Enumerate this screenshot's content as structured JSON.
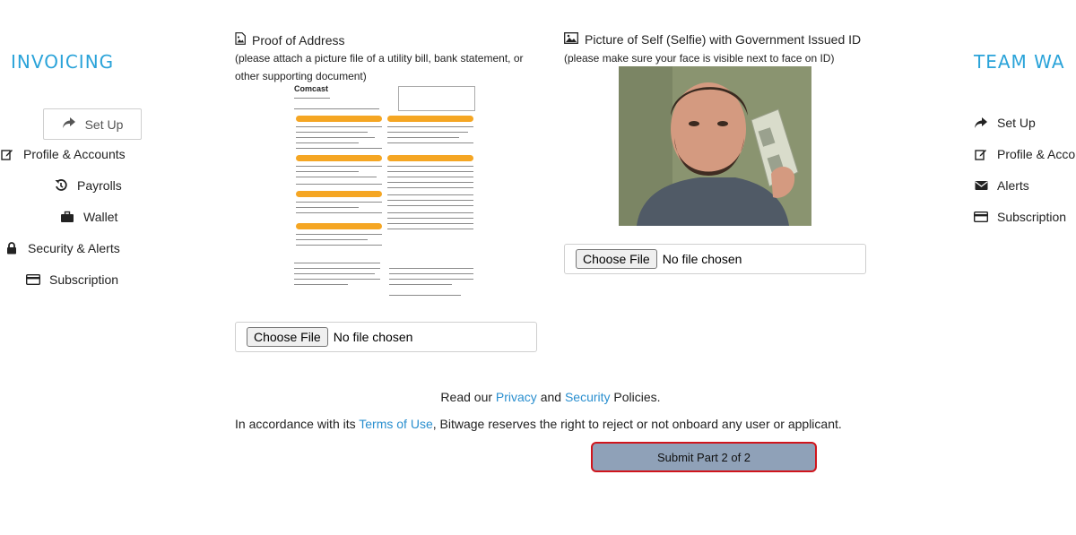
{
  "left_nav": {
    "title": "INVOICING",
    "setup_label": "Set Up",
    "items": [
      {
        "label": "Profile & Accounts",
        "icon": "edit-icon"
      },
      {
        "label": "Payrolls",
        "icon": "history-icon"
      },
      {
        "label": "Wallet",
        "icon": "briefcase-icon"
      },
      {
        "label": "Security & Alerts",
        "icon": "lock-icon"
      },
      {
        "label": "Subscription",
        "icon": "credit-card-icon"
      }
    ]
  },
  "right_nav": {
    "title": "TEAM WA",
    "setup_label": "Set Up",
    "items": [
      {
        "label": "Profile & Accou",
        "icon": "edit-icon"
      },
      {
        "label": "Alerts",
        "icon": "envelope-icon"
      },
      {
        "label": "Subscription",
        "icon": "credit-card-icon"
      }
    ]
  },
  "proof_of_address": {
    "heading": "Proof of Address",
    "note": "(please attach a picture file of a utility bill, bank statement, or other supporting document)",
    "doc_brand": "Comcast",
    "file_button": "Choose File",
    "file_status": "No file chosen"
  },
  "selfie": {
    "heading": "Picture of Self (Selfie) with Government Issued ID",
    "note": "(please make sure your face is visible next to face on ID)",
    "file_button": "Choose File",
    "file_status": "No file chosen"
  },
  "policies": {
    "prefix": "Read our",
    "privacy_link": "Privacy",
    "and": "and",
    "security_link": "Security",
    "suffix": "Policies."
  },
  "terms": {
    "prefix": "In accordance with its",
    "terms_link": "Terms of Use",
    "suffix": ", Bitwage reserves the right to reject or not onboard any user or applicant."
  },
  "submit_label": "Submit Part 2 of 2",
  "colors": {
    "accent": "#2aa3d9",
    "link": "#2a8fcf",
    "submit_bg": "#8fa1b8",
    "submit_border": "#d0151c"
  }
}
